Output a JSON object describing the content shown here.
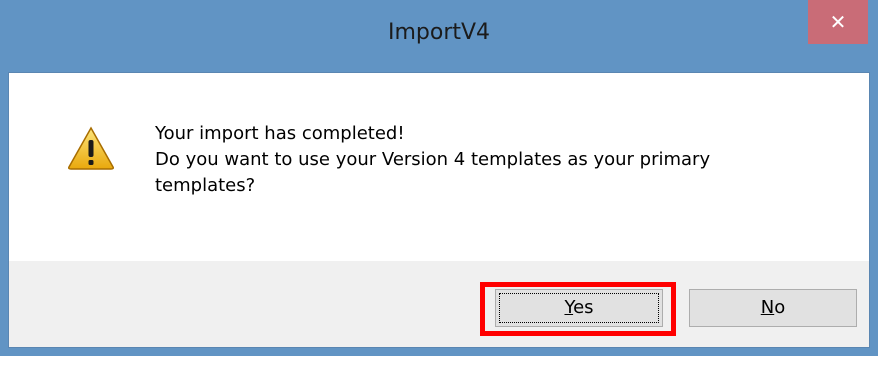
{
  "window": {
    "title": "ImportV4",
    "close_glyph": "✕"
  },
  "message": {
    "icon": "warning-icon",
    "lines": [
      "Your import has completed!",
      "Do you want to use your Version 4 templates as your primary",
      "templates?"
    ]
  },
  "buttons": {
    "yes": {
      "accel": "Y",
      "rest": "es"
    },
    "no": {
      "accel": "N",
      "rest": "o"
    }
  },
  "annotation": {
    "highlight_color": "#ff0000"
  }
}
